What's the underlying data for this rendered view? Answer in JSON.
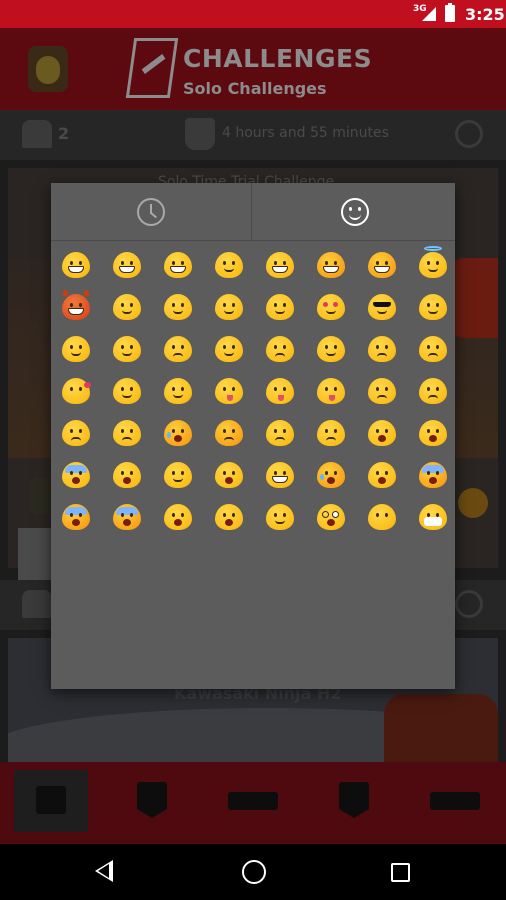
{
  "status_bar": {
    "network": "3G",
    "time": "3:25"
  },
  "app_header": {
    "title": "CHALLENGES",
    "subtitle": "Solo Challenges"
  },
  "background": {
    "participants": "2",
    "time_remaining": "4 hours and 55 minutes",
    "challenge_title": "Solo Time Trial Challenge",
    "vehicle_name": "Kawasaki Ninja H2"
  },
  "emoji_picker": {
    "tabs": [
      {
        "name": "recent-tab",
        "icon": "clock-icon",
        "selected": false
      },
      {
        "name": "smileys-tab",
        "icon": "smiley-icon",
        "selected": true
      }
    ],
    "emojis": [
      "grinning-face-icon",
      "grimacing-face-icon",
      "beaming-face-icon",
      "smiling-face-icon",
      "grinning-face-with-sweat-icon",
      "laughing-face-icon",
      "squinting-laughing-face-icon",
      "halo-face-icon",
      "devil-face-icon",
      "winking-face-icon",
      "blushing-face-icon",
      "smirking-face-icon",
      "relieved-face-icon",
      "heart-eyes-face-icon",
      "sunglasses-face-icon",
      "smirk-face-icon",
      "neutral-face-icon",
      "expressionless-face-icon",
      "unamused-face-icon",
      "sweat-face-icon",
      "pensive-face-icon",
      "confused-face-icon",
      "persevering-face-icon",
      "confounded-face-icon",
      "kissing-heart-face-icon",
      "kissing-face-icon",
      "kissing-closed-eyes-face-icon",
      "tongue-face-icon",
      "winking-tongue-face-icon",
      "squinting-tongue-face-icon",
      "disappointed-face-icon",
      "worried-face-icon",
      "angry-face-icon",
      "pouting-face-icon",
      "crying-face-icon",
      "persevere-face-icon",
      "triumph-face-icon",
      "disappointed-relieved-face-icon",
      "frowning-open-face-icon",
      "anguished-face-icon",
      "fearful-face-icon",
      "weary-face-icon",
      "sleepy-face-icon",
      "tired-face-icon",
      "grimacing-teeth-face-icon",
      "loudly-crying-face-icon",
      "hushed-face-icon",
      "screaming-face-icon",
      "cold-sweat-face-icon",
      "scream-in-fear-face-icon",
      "astonished-face-icon",
      "flushed-face-icon",
      "sleeping-face-icon",
      "dizzy-face-icon",
      "no-mouth-face-icon",
      "medical-mask-face-icon"
    ]
  },
  "bottom_nav": [
    {
      "name": "tab-trophy",
      "icon": "trophy-icon",
      "selected": true
    },
    {
      "name": "tab-challenge-badge",
      "icon": "trophy-shield-icon",
      "selected": false
    },
    {
      "name": "tab-group",
      "icon": "group-icon",
      "selected": false
    },
    {
      "name": "tab-club-badge",
      "icon": "group-shield-icon",
      "selected": false
    },
    {
      "name": "tab-profile-plate",
      "icon": "plate-icon",
      "selected": false
    }
  ],
  "colors": {
    "status_bar": "#c0101f",
    "dialog": "#5c5c5c",
    "emoji_yellow": "#fbbf1b"
  }
}
